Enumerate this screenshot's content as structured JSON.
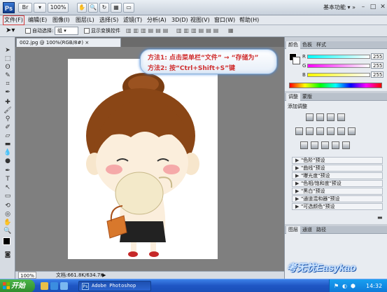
{
  "app": {
    "logo_text": "Ps",
    "zoom": "100%",
    "workspace": "基本功能",
    "win_controls": [
      "–",
      "□",
      "✕"
    ]
  },
  "menubar": {
    "items": [
      "文件(F)",
      "编辑(E)",
      "图像(I)",
      "图层(L)",
      "选择(S)",
      "滤镜(T)",
      "分析(A)",
      "3D(D)",
      "视图(V)",
      "窗口(W)",
      "帮助(H)"
    ],
    "active_index": 0
  },
  "optionsbar": {
    "auto_select": "自动选择:",
    "auto_select_value": "组",
    "show_transform": "显示变换控件"
  },
  "document": {
    "tab_title": "002.jpg @ 100%(RGB/8#)",
    "zoom": "100%",
    "doc_info": "文档:661.8K/634.7K"
  },
  "callout": {
    "line1": "方法1: 点击菜单栏“文件” → “存储为”",
    "line2": "方法2: 按“Ctrl+Shift+S”键"
  },
  "panels": {
    "color_tabs": [
      "颜色",
      "色板",
      "样式"
    ],
    "sliders": [
      {
        "label": "R",
        "value": "255"
      },
      {
        "label": "G",
        "value": "255"
      },
      {
        "label": "B",
        "value": "255"
      }
    ],
    "adjust_tabs": [
      "调整",
      "蒙版"
    ],
    "adjust_title": "添加调整",
    "presets": [
      "\"色阶\"预设",
      "\"曲线\"预设",
      "\"曝光度\"预设",
      "\"色相/饱和度\"预设",
      "\"黑白\"预设",
      "\"通道混和器\"预设",
      "\"可选颜色\"预设"
    ],
    "layer_tabs": [
      "图层",
      "通道",
      "路径"
    ]
  },
  "taskbar": {
    "start": "开始",
    "task_item": "Adobe Photoshop",
    "clock": "14:32"
  },
  "watermark": "考无忧Easykao",
  "colors": {
    "callout_text": "#d03030",
    "active_menu_border": "#d23b3b",
    "taskbar": "#1f56c4"
  }
}
